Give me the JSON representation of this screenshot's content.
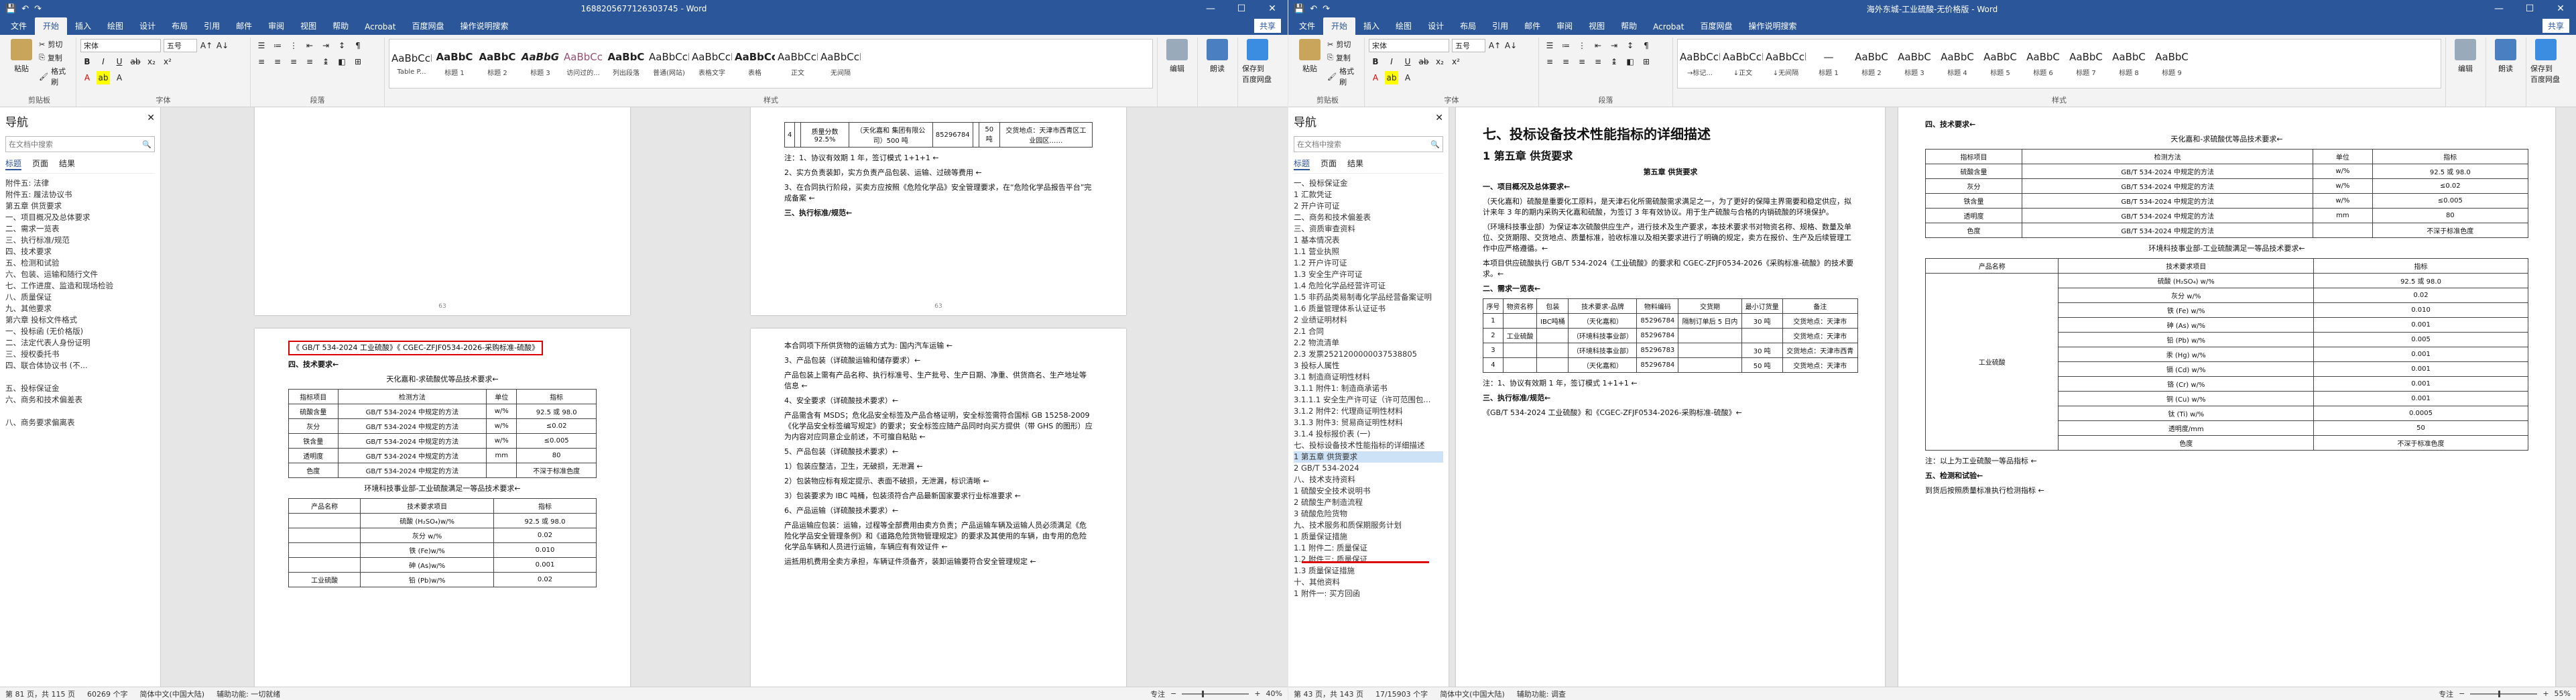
{
  "left": {
    "title": "1688205677126303745 - Word",
    "tabs": [
      "文件",
      "开始",
      "插入",
      "绘图",
      "设计",
      "布局",
      "引用",
      "邮件",
      "审阅",
      "视图",
      "帮助",
      "Acrobat",
      "百度网盘"
    ],
    "tell_me": "操作说明搜索",
    "share": "共享",
    "clipboard": {
      "paste": "粘贴",
      "cut": "剪切",
      "copy": "复制",
      "format_painter": "格式刷",
      "label": "剪贴板"
    },
    "font": {
      "name": "宋体",
      "size": "五号",
      "label": "字体"
    },
    "paragraph_label": "段落",
    "styles": [
      {
        "preview": "AaBbCcI",
        "name": "Table P..."
      },
      {
        "preview": "AaBbC",
        "name": "标题 1"
      },
      {
        "preview": "AaBbC",
        "name": "标题 2"
      },
      {
        "preview": "AaBbG",
        "name": "标题 3"
      },
      {
        "preview": "AaBbCc",
        "name": "访问过的..."
      },
      {
        "preview": "AaBbC",
        "name": "列出段落"
      },
      {
        "preview": "AaBbCcD",
        "name": "普通(网站)"
      },
      {
        "preview": "AaBbCcI",
        "name": "表格文字"
      },
      {
        "preview": "AaBbCcI",
        "name": "表格"
      },
      {
        "preview": "AaBbCcDdE",
        "name": "正文"
      },
      {
        "preview": "AaBbCcDdE",
        "name": "无间隔"
      }
    ],
    "styles_label": "样式",
    "editing": "编辑",
    "read_aloud": "朗读",
    "save_baidu": "保存到\n百度网盘",
    "nav": {
      "title": "导航",
      "search": "在文档中搜索",
      "tabs": [
        "标题",
        "页面",
        "结果"
      ],
      "items": [
        "附件五: 法律",
        "附件五: 履法协议书",
        "第五章  供货要求",
        "一、项目概况及总体要求",
        "二、需求一览表",
        "三、执行标准/规范",
        "四、技术要求",
        "五、检测和试验",
        "六、包装、运输和随行文件",
        "七、工作进度、监造和现场检验",
        "八、质量保证",
        "九、其他要求",
        "第六章  投标文件格式",
        "一、投标函 (无价格版)",
        "二、法定代表人身份证明",
        "三、授权委托书",
        "四、联合体协议书 (不...",
        "",
        "五、投标保证金",
        "六、商务和技术偏差表",
        "",
        "八、商务要求偏离表"
      ]
    },
    "page1": {
      "table_top": [
        [
          "4",
          "",
          "质量分数 92.5%",
          "（天化嘉和 集团有限公司）500 吨",
          "85296784",
          "",
          "50 吨",
          "交货地点：天津市西青区工业园区……"
        ]
      ],
      "lines": [
        "注：1、协议有效期 1 年，签订模式 1+1+1 ←",
        "2、实方负责装卸，实方负责产品包装、运输、过磅等费用 ←",
        "3、在合同执行阶段，买卖方应按照《危险化学品》安全管理要求，在“危险化学品报告平台”完成备案 ←",
        "三、执行标准/规范←"
      ],
      "num": "63"
    },
    "page2": {
      "highlight": "《 GB/T 534-2024 工业硫酸》《 CGEC-ZFJF0534-2026-采购标准-硫酸》",
      "section": "四、技术要求←",
      "table_title": "天化嘉和-求硫酸优等品技术要求←",
      "headers": [
        "指标项目",
        "检测方法",
        "单位",
        "指标"
      ],
      "rows": [
        [
          "硫酸含量",
          "GB/T 534-2024 中规定的方法",
          "w/%",
          "92.5 或 98.0"
        ],
        [
          "灰分",
          "GB/T 534-2024 中规定的方法",
          "w/%",
          "≤0.02"
        ],
        [
          "铁含量",
          "GB/T 534-2024 中规定的方法",
          "w/%",
          "≤0.005"
        ],
        [
          "透明度",
          "GB/T 534-2024 中规定的方法",
          "mm",
          "80"
        ],
        [
          "色度",
          "GB/T 534-2024 中规定的方法",
          "",
          "不深于标准色度"
        ]
      ],
      "table2_title": "环境科技事业部-工业硫酸满足一等品技术要求←",
      "headers2": [
        "产品名称",
        "技术要求项目",
        "指标"
      ],
      "rows2": [
        [
          "",
          "硫酸 (H₂SO₄)w/%",
          "92.5 或 98.0"
        ],
        [
          "",
          "灰分 w/%",
          "0.02"
        ],
        [
          "",
          "铁 (Fe)w/%",
          "0.010"
        ],
        [
          "",
          "砷 (As)w/%",
          "0.001"
        ],
        [
          "工业硫酸",
          "铅 (Pb)w/%",
          "0.02"
        ]
      ]
    },
    "page3": {
      "lines": [
        "本合同项下所供货物的运输方式为: 国内汽车运输 ←",
        "3、产品包装（详硫酸运输和储存要求）←",
        "产品包装上需有产品名称、执行标准号、生产批号、生产日期、净重、供货商名、生产地址等信息 ←",
        "4、安全要求（详硫酸技术要求）←",
        "产品需含有 MSDS；危化品安全标签及产品合格证明，安全标签需符合国标 GB 15258-2009《化学品安全标签编写规定》的要求；安全标签应随产品同时向买方提供（带 GHS 的图形）应为内容对应同意企业前述，不可擅自粘贴 ←",
        "5、产品包装（详硫酸技术要求）←",
        "1）包装应整洁，卫生，无破损，无泄漏 ←",
        "2）包装物应标有规定提示、表面不破损，无泄漏，标识清晰 ←",
        "3）包装要求为 IBC 吨桶，包装须符合产品最新国家要求行业标准要求 ←",
        "6、产品运输（详硫酸技术要求）←",
        "产品运输应包装：运输，过程等全部费用由卖方负责；产品运输车辆及运输人员必须满足《危险化学品安全管理条例》和《道路危险货物管理规定》的要求及其使用的车辆，由专用的危险化学品车辆和人员进行运输，车辆应有有效证件 ←",
        "运抵用机费用全卖方承担，车辆证件须备齐，装卸运输要符合安全管理规定 ←"
      ]
    },
    "status": {
      "page": "第 81 页，共 115 页",
      "words": "60269 个字",
      "lang": "简体中文(中国大陆)",
      "assist": "辅助功能: 一切就绪",
      "focus": "专注",
      "zoom": "40%"
    }
  },
  "right": {
    "title": "海外东城-工业硫酸-无价格版 - Word",
    "tabs": [
      "文件",
      "开始",
      "插入",
      "绘图",
      "设计",
      "布局",
      "引用",
      "邮件",
      "审阅",
      "视图",
      "帮助",
      "Acrobat",
      "百度网盘"
    ],
    "tell_me": "操作说明搜索",
    "share": "共享",
    "styles": [
      {
        "preview": "AaBbCcDd",
        "name": "→标记..."
      },
      {
        "preview": "AaBbCcI",
        "name": "↓正文"
      },
      {
        "preview": "AaBbCcl",
        "name": "↓无间隔"
      },
      {
        "preview": "—",
        "name": "标题 1"
      },
      {
        "preview": "AaBbC",
        "name": "标题 2"
      },
      {
        "preview": "AaBbC",
        "name": "标题 3"
      },
      {
        "preview": "AaBbC",
        "name": "标题 4"
      },
      {
        "preview": "AaBbC",
        "name": "标题 5"
      },
      {
        "preview": "AaBbC",
        "name": "标题 6"
      },
      {
        "preview": "AaBbC",
        "name": "标题 7"
      },
      {
        "preview": "AaBbC",
        "name": "标题 8"
      },
      {
        "preview": "AaBbC",
        "name": "标题 9"
      }
    ],
    "nav": {
      "title": "导航",
      "search": "在文档中搜索",
      "tabs": [
        "标题",
        "页面",
        "结果"
      ],
      "items": [
        "一、投标保证金",
        "1 汇款凭证",
        "2 开户许可证",
        "二、商务和技术偏差表",
        "三、资质审查资料",
        "1 基本情况表",
        "1.1 营业执照",
        "1.2 开户许可证",
        "1.3 安全生产许可证",
        "1.4 危险化学品经营许可证",
        "1.5 非药品类易制毒化学品经营备案证明",
        "1.6 质量管理体系认证证书",
        "2 业绩证明材料",
        "2.1 合同",
        "2.2 物流清单",
        "2.3 发票2521200000037538805",
        "3 投标人属性",
        "3.1 制造商证明性材料",
        "3.1.1 附件1: 制造商承诺书",
        "3.1.1.1 安全生产许可证（许可范围包...",
        "3.1.2 附件2: 代理商证明性材料",
        "3.1.3 附件3: 贸易商证明性材料",
        "3.1.4 投标报价表 (一)",
        "七、投标设备技术性能指标的详细描述",
        "1 第五章  供货要求",
        "2 GB/T 534-2024",
        "八、技术支持资料",
        "1 硫酸安全技术说明书",
        "2 硫酸生产制造流程",
        "3 硫酸危险货物",
        "九、技术服务和质保期服务计划",
        "1 质量保证措施",
        "1.1 附件二: 质量保证",
        "1.2 附件三: 质量保证",
        "1.3 质量保证措施",
        "十、其他资料",
        "1 附件一: 买方回函"
      ]
    },
    "page1": {
      "h1": "七、投标设备技术性能指标的详细描述",
      "h2": "1 第五章  供货要求",
      "center": "第五章  供货要求",
      "s1": "一、项目概况及总体要求←",
      "paras": [
        "（天化嘉和）硫酸是重要化工原料，是天津石化所需硫酸需求满足之一，为了更好的保障主界需要和稳定供应，拟计来年 3 年的期内采购天化嘉和硫酸，为签订 3 年有效协议。用于生产硫酸与合格的内销硫酸的环境保护。",
        "（环境科技事业部）为保证本次硫酸供应生产，进行技术及生产要求，本技术要求书对物资名称、规格、数量及单位、交货期限、交货地点、质量标准，验收标准以及相关要求进行了明确的规定，卖方在报价、生产及后续管理工作中应严格遵循。←",
        "本项目供应硫酸执行 GB/T 534-2024《工业硫酸》的要求和 CGEC-ZFJF0534-2026《采购标准-硫酸》的技术要求。←"
      ],
      "s2": "二、需求一览表←",
      "headers": [
        "序号",
        "物资名称",
        "包装",
        "技术要求-品牌",
        "物料编码",
        "交货期",
        "最小订货量",
        "备注"
      ],
      "rows": [
        [
          "1",
          "",
          "IBC吨桶",
          "（天化嘉和）",
          "85296784",
          "隔制订单后 5 日内",
          "30 吨",
          "交货地点：天津市"
        ],
        [
          "2",
          "工业硫酸",
          "",
          "（环境科技事业部）",
          "85296784",
          "",
          "",
          "交货地点：天津市"
        ],
        [
          "3",
          "",
          "",
          "（环境科技事业部）",
          "85296783",
          "",
          "30 吨",
          "交货地点：天津市西青"
        ],
        [
          "4",
          "",
          "",
          "（天化嘉和）",
          "85296784",
          "",
          "50 吨",
          "交货地点：天津市"
        ]
      ],
      "note": "注：1、协议有效期 1 年，签订模式 1+1+1 ←",
      "s3": "三、执行标准/规范←",
      "std": "《GB/T 534-2024 工业硫酸》和《CGEC-ZFJF0534-2026-采购标准-硫酸》←"
    },
    "page2": {
      "s4": "四、技术要求←",
      "t1_title": "天化嘉和-求硫酸优等品技术要求←",
      "headers": [
        "指标项目",
        "检测方法",
        "单位",
        "指标"
      ],
      "rows": [
        [
          "硫酸含量",
          "GB/T 534-2024 中规定的方法",
          "w/%",
          "92.5 或 98.0"
        ],
        [
          "灰分",
          "GB/T 534-2024 中规定的方法",
          "w/%",
          "≤0.02"
        ],
        [
          "铁含量",
          "GB/T 534-2024 中规定的方法",
          "w/%",
          "≤0.005"
        ],
        [
          "透明度",
          "GB/T 534-2024 中规定的方法",
          "mm",
          "80"
        ],
        [
          "色度",
          "GB/T 534-2024 中规定的方法",
          "",
          "不深于标准色度"
        ]
      ],
      "t2_title": "环境科技事业部-工业硫酸满足一等品技术要求←",
      "headers2": [
        "产品名称",
        "技术要求项目",
        "指标"
      ],
      "rows2": [
        [
          "硫酸 (H₂SO₄) w/%",
          "92.5 或 98.0"
        ],
        [
          "灰分 w/%",
          "0.02"
        ],
        [
          "铁 (Fe) w/%",
          "0.010"
        ],
        [
          "砷 (As) w/%",
          "0.001"
        ],
        [
          "铅 (Pb) w/%",
          "0.005"
        ],
        [
          "汞 (Hg) w/%",
          "0.001"
        ],
        [
          "镉 (Cd) w/%",
          "0.001"
        ],
        [
          "铬 (Cr) w/%",
          "0.001"
        ],
        [
          "铜 (Cu) w/%",
          "0.001"
        ],
        [
          "钛 (Ti) w/%",
          "0.0005"
        ],
        [
          "透明度/mm",
          "50"
        ],
        [
          "色度",
          "不深于标准色度"
        ]
      ],
      "product": "工业硫酸",
      "note": "注：以上为工业硫酸一等品指标 ←",
      "s5": "五、检测和试验←",
      "s5text": "到货后按照质量标准执行检测指标 ←"
    },
    "status": {
      "page": "第 43 页，共 143 页",
      "words": "17/15903 个字",
      "lang": "简体中文(中国大陆)",
      "assist": "辅助功能: 调查",
      "focus": "专注",
      "zoom": "55%"
    }
  }
}
